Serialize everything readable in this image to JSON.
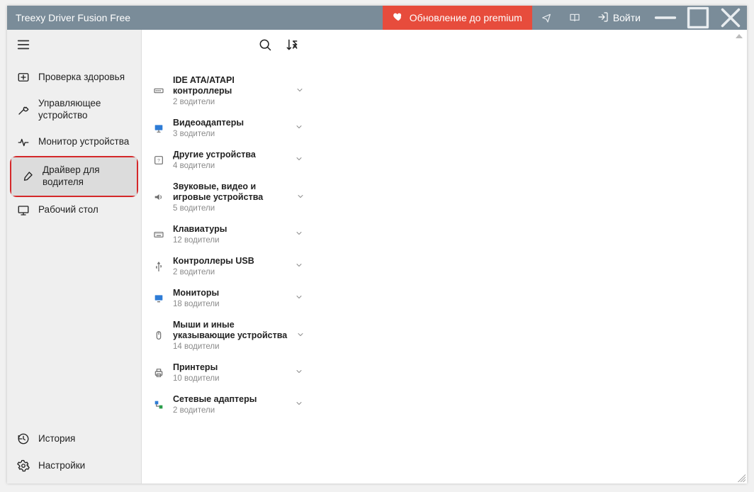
{
  "window": {
    "title": "Treexy Driver Fusion Free"
  },
  "titlebar": {
    "premium_label": "Обновление до premium",
    "login_label": "Войти"
  },
  "sidebar": {
    "items": [
      {
        "icon": "health-icon",
        "label": "Проверка здоровья"
      },
      {
        "icon": "wrench-icon",
        "label": "Управляющее устройство"
      },
      {
        "icon": "pulse-icon",
        "label": "Монитор устройства"
      },
      {
        "icon": "brush-icon",
        "label": "Драйвер для водителя"
      },
      {
        "icon": "desktop-icon",
        "label": "Рабочий стол"
      }
    ],
    "bottom": [
      {
        "icon": "history-icon",
        "label": "История"
      },
      {
        "icon": "gear-icon",
        "label": "Настройки"
      }
    ],
    "selected_index": 3
  },
  "categories": [
    {
      "icon": "ide-icon",
      "name": "IDE ATA/ATAPI контроллеры",
      "sub": "2 водители"
    },
    {
      "icon": "display-icon",
      "name": "Видеоадаптеры",
      "sub": "3 водители"
    },
    {
      "icon": "other-icon",
      "name": "Другие устройства",
      "sub": "4 водители"
    },
    {
      "icon": "sound-icon",
      "name": "Звуковые, видео и игровые устройства",
      "sub": "5 водители"
    },
    {
      "icon": "keyboard-icon",
      "name": "Клавиатуры",
      "sub": "12 водители"
    },
    {
      "icon": "usb-icon",
      "name": "Контроллеры USB",
      "sub": "2 водители"
    },
    {
      "icon": "monitor-icon",
      "name": "Мониторы",
      "sub": "18 водители"
    },
    {
      "icon": "mouse-icon",
      "name": "Мыши и иные указывающие устройства",
      "sub": "14 водители"
    },
    {
      "icon": "printer-icon",
      "name": "Принтеры",
      "sub": "10 водители"
    },
    {
      "icon": "network-icon",
      "name": "Сетевые адаптеры",
      "sub": "2 водители"
    }
  ],
  "colors": {
    "titlebar": "#7a8c99",
    "premium": "#e74c3c",
    "sidebar": "#efefef",
    "highlight_border": "#d4282a"
  }
}
